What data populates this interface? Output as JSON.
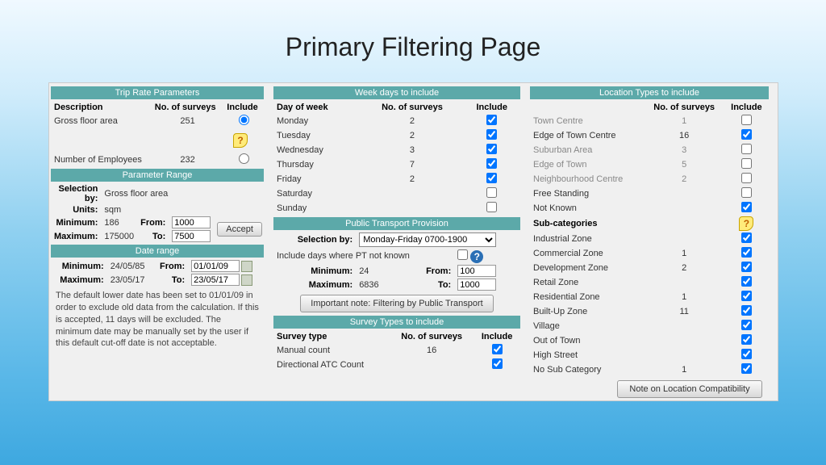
{
  "title": "Primary Filtering Page",
  "tripRate": {
    "heading": "Trip Rate Parameters",
    "cols": {
      "desc": "Description",
      "count": "No. of surveys",
      "include": "Include"
    },
    "rows": [
      {
        "desc": "Gross floor area",
        "count": "251",
        "selected": true
      },
      {
        "desc": "Number of Employees",
        "count": "232",
        "selected": false
      }
    ]
  },
  "paramRange": {
    "heading": "Parameter Range",
    "labels": {
      "selection": "Selection by:",
      "units": "Units:",
      "min": "Minimum:",
      "max": "Maximum:",
      "from": "From:",
      "to": "To:",
      "accept": "Accept"
    },
    "selection": "Gross floor area",
    "units": "sqm",
    "min": "186",
    "max": "175000",
    "from": "1000",
    "to": "7500"
  },
  "dateRange": {
    "heading": "Date range",
    "labels": {
      "min": "Minimum:",
      "max": "Maximum:",
      "from": "From:",
      "to": "To:"
    },
    "min": "24/05/85",
    "max": "23/05/17",
    "from": "01/01/09",
    "to": "23/05/17",
    "note": "The default lower date has been set to 01/01/09 in order to exclude old data from the calculation. If this is accepted, 11 days will be excluded. The minimum date may be manually set by the user if this default cut-off date is not acceptable."
  },
  "weekDays": {
    "heading": "Week days to include",
    "cols": {
      "day": "Day of week",
      "count": "No. of surveys",
      "include": "Include"
    },
    "rows": [
      {
        "day": "Monday",
        "count": "2",
        "on": true
      },
      {
        "day": "Tuesday",
        "count": "2",
        "on": true
      },
      {
        "day": "Wednesday",
        "count": "3",
        "on": true
      },
      {
        "day": "Thursday",
        "count": "7",
        "on": true
      },
      {
        "day": "Friday",
        "count": "2",
        "on": true
      },
      {
        "day": "Saturday",
        "count": "",
        "on": false
      },
      {
        "day": "Sunday",
        "count": "",
        "on": false
      }
    ]
  },
  "pt": {
    "heading": "Public Transport Provision",
    "labels": {
      "selection": "Selection by:",
      "unknown": "Include days where PT not known",
      "min": "Minimum:",
      "max": "Maximum:",
      "from": "From:",
      "to": "To:"
    },
    "selection": "Monday-Friday 0700-1900",
    "min": "24",
    "max": "6836",
    "from": "100",
    "to": "1000",
    "noteBtn": "Important note: Filtering by Public Transport"
  },
  "surveyTypes": {
    "heading": "Survey Types to include",
    "cols": {
      "type": "Survey type",
      "count": "No. of surveys",
      "include": "Include"
    },
    "rows": [
      {
        "type": "Manual count",
        "count": "16",
        "on": true
      },
      {
        "type": "Directional ATC Count",
        "count": "",
        "on": true
      }
    ]
  },
  "location": {
    "heading": "Location Types to include",
    "cols": {
      "count": "No. of surveys",
      "include": "Include"
    },
    "subHeading": "Sub-categories",
    "main": [
      {
        "name": "Town Centre",
        "count": "1",
        "on": false,
        "grey": true
      },
      {
        "name": "Edge of Town Centre",
        "count": "16",
        "on": true
      },
      {
        "name": "Suburban Area",
        "count": "3",
        "on": false,
        "grey": true
      },
      {
        "name": "Edge of Town",
        "count": "5",
        "on": false,
        "grey": true
      },
      {
        "name": "Neighbourhood Centre",
        "count": "2",
        "on": false,
        "grey": true
      },
      {
        "name": "Free Standing",
        "count": "",
        "on": false
      },
      {
        "name": "Not Known",
        "count": "",
        "on": true
      }
    ],
    "sub": [
      {
        "name": "Industrial Zone",
        "count": "",
        "on": true
      },
      {
        "name": "Commercial Zone",
        "count": "1",
        "on": true
      },
      {
        "name": "Development Zone",
        "count": "2",
        "on": true
      },
      {
        "name": "Retail Zone",
        "count": "",
        "on": true
      },
      {
        "name": "Residential Zone",
        "count": "1",
        "on": true
      },
      {
        "name": "Built-Up Zone",
        "count": "11",
        "on": true
      },
      {
        "name": "Village",
        "count": "",
        "on": true
      },
      {
        "name": "Out of Town",
        "count": "",
        "on": true
      },
      {
        "name": "High Street",
        "count": "",
        "on": true
      },
      {
        "name": "No Sub Category",
        "count": "1",
        "on": true
      }
    ],
    "noteBtn": "Note on Location Compatibility"
  }
}
